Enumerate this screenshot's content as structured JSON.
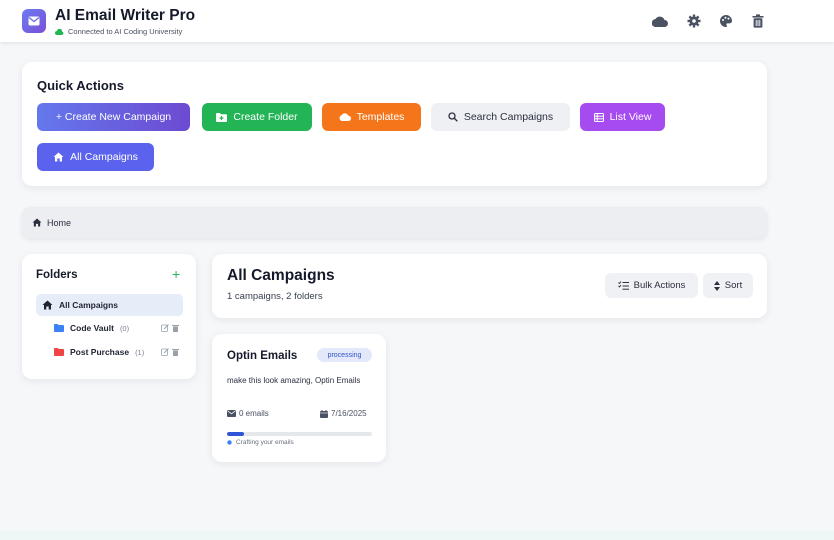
{
  "app": {
    "title": "AI Email Writer Pro",
    "connection": "Connected to AI Coding University",
    "brand_gradient": [
      "#6c7bf2",
      "#7a4fd6"
    ],
    "connected_color": "#22b455"
  },
  "header_icons": [
    "cloud-icon",
    "gear-icon",
    "palette-icon",
    "trash-icon"
  ],
  "quick_actions": {
    "title": "Quick Actions",
    "buttons": [
      {
        "label": "+ Create New Campaign",
        "color": "#6a5fd6"
      },
      {
        "label": "Create Folder",
        "color": "#22b455"
      },
      {
        "label": "Templates",
        "color": "#f5761a"
      },
      {
        "label": "Search Campaigns",
        "color": "#eef0f3"
      },
      {
        "label": "List View",
        "color": "#a64bf0"
      },
      {
        "label": "All Campaigns",
        "color": "#5b63ee"
      }
    ]
  },
  "breadcrumb": {
    "home": "Home"
  },
  "folders": {
    "title": "Folders",
    "add": "+",
    "all": "All Campaigns",
    "items": [
      {
        "name": "Code Vault",
        "count": "(0)",
        "color": "#3b82f6"
      },
      {
        "name": "Post Purchase",
        "count": "(1)",
        "color": "#ef4444"
      }
    ]
  },
  "main": {
    "title": "All Campaigns",
    "subtitle": "1 campaigns, 2 folders",
    "bulk_label": "Bulk Actions",
    "sort_label": "Sort"
  },
  "campaign": {
    "name": "Optin Emails",
    "status": "processing",
    "description": "make this look amazing, Optin Emails",
    "emails": "0 emails",
    "date": "7/16/2025",
    "progress": 0.12,
    "progress_label": "Crafting your emails"
  }
}
